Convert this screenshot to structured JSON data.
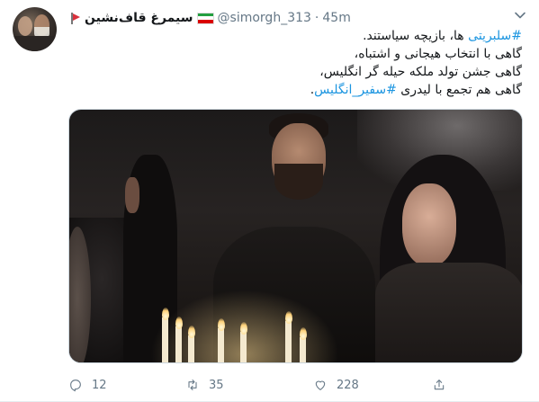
{
  "tweet": {
    "display_name": "سیمرغ قاف‌نشین",
    "username": "@simorgh_313",
    "separator": "·",
    "time": "45m",
    "text_lines": [
      {
        "hashtag": "#سلبریتی",
        "rest": " ها، بازیچه سیاستند."
      },
      {
        "text": "گاهی با انتخاب هیجانی و اشتباه،"
      },
      {
        "text": "گاهی جشن تولد ملکه حیله گر انگلیس،"
      },
      {
        "text": "گاهی هم تجمع با لیدری ",
        "hashtag": "#سفیر_انگلیس",
        "after": "."
      }
    ],
    "actions": {
      "replies": "12",
      "retweets": "35",
      "likes": "228"
    }
  },
  "colors": {
    "hashtag": "#1b95e0",
    "secondary_text": "#657786",
    "flag_green": "#239f40",
    "flag_white": "#ffffff",
    "flag_red": "#da0000"
  },
  "icons": [
    "red-flag-icon",
    "iran-flag-icon",
    "chevron-down-icon",
    "reply-icon",
    "retweet-icon",
    "like-icon",
    "share-icon"
  ]
}
